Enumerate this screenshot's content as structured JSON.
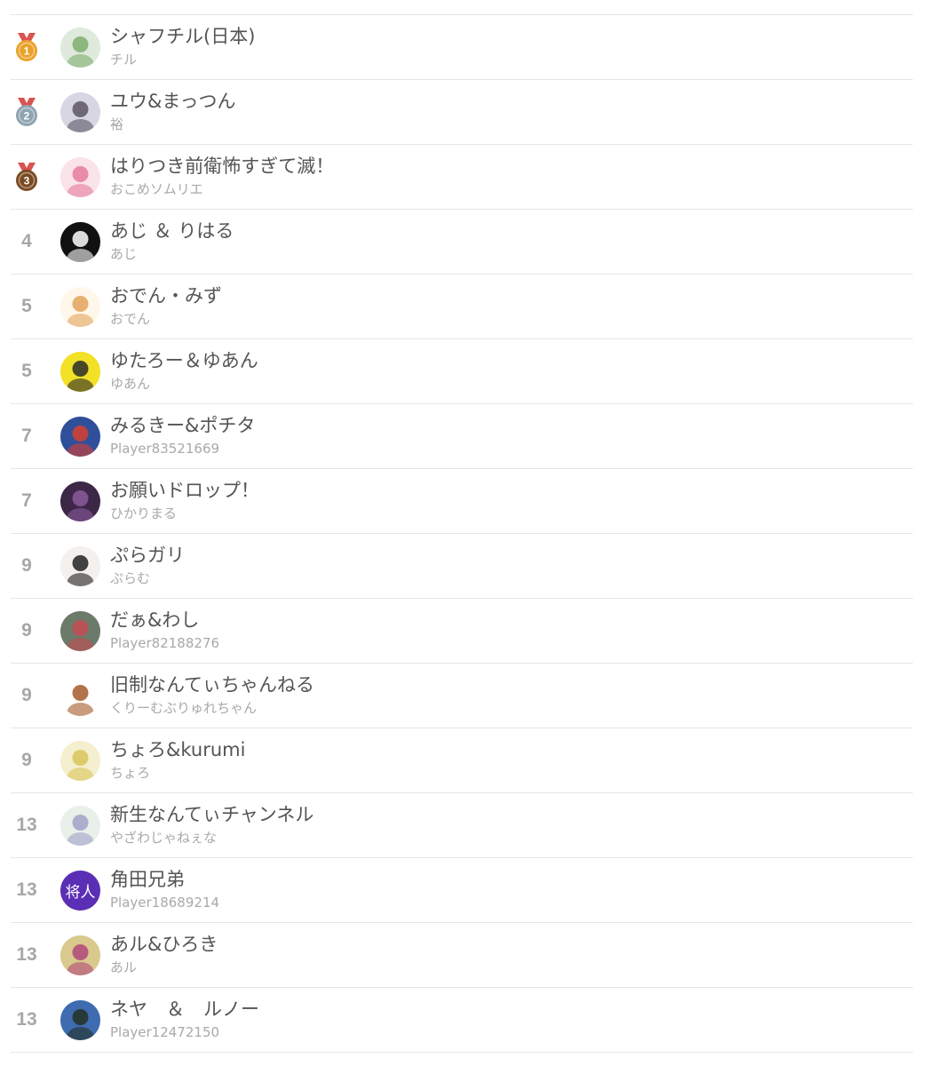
{
  "ranking": {
    "rows": [
      {
        "rank": "1",
        "medal": "gold",
        "name": "シャフチル(日本)",
        "player": "チル",
        "avatar": "avatar-white-character-icon",
        "avatar_bg": "#dfe9dc",
        "avatar_fg": "#7fae6f"
      },
      {
        "rank": "2",
        "medal": "silver",
        "name": "ユウ&まっつん",
        "player": "裕",
        "avatar": "avatar-anime-character-icon",
        "avatar_bg": "#d9d6e4",
        "avatar_fg": "#5a5566"
      },
      {
        "rank": "3",
        "medal": "bronze",
        "name": "はりつき前衛怖すぎて滅！",
        "player": "おこめソムリエ",
        "avatar": "avatar-pink-mushroom-icon",
        "avatar_bg": "#fbe3ea",
        "avatar_fg": "#e67c9b"
      },
      {
        "rank": "4",
        "medal": "",
        "name": "あじ ＆ りはる",
        "player": "あじ",
        "avatar": "avatar-black-logo-icon",
        "avatar_bg": "#111111",
        "avatar_fg": "#ffffff"
      },
      {
        "rank": "5",
        "medal": "",
        "name": "おでん・みず",
        "player": "おでん",
        "avatar": "avatar-sketch-character-icon",
        "avatar_bg": "#fff7ea",
        "avatar_fg": "#e3a35a"
      },
      {
        "rank": "5",
        "medal": "",
        "name": "ゆたろー＆ゆあん",
        "player": "ゆあん",
        "avatar": "avatar-yellow-character-icon",
        "avatar_bg": "#f2e125",
        "avatar_fg": "#2a2a2a"
      },
      {
        "rank": "7",
        "medal": "",
        "name": "みるきー&ポチタ",
        "player": "Player83521669",
        "avatar": "avatar-game-scene-icon",
        "avatar_bg": "#2f4f9b",
        "avatar_fg": "#d8402e"
      },
      {
        "rank": "7",
        "medal": "",
        "name": "お願いドロップ！",
        "player": "ひかりまる",
        "avatar": "avatar-purple-room-icon",
        "avatar_bg": "#3c2747",
        "avatar_fg": "#8a5c9c"
      },
      {
        "rank": "9",
        "medal": "",
        "name": "ぷらガリ",
        "player": "ぷらむ",
        "avatar": "avatar-squid-character-icon",
        "avatar_bg": "#f3f0ee",
        "avatar_fg": "#222222"
      },
      {
        "rank": "9",
        "medal": "",
        "name": "だぁ&わし",
        "player": "Player82188276",
        "avatar": "avatar-figure-icon",
        "avatar_bg": "#6c7a6a",
        "avatar_fg": "#c44b52"
      },
      {
        "rank": "9",
        "medal": "",
        "name": "旧制なんてぃちゃんねる",
        "player": "くりーむぶりゅれちゃん",
        "avatar": "avatar-brown-dog-icon",
        "avatar_bg": "#ffffff",
        "avatar_fg": "#a65a2a"
      },
      {
        "rank": "9",
        "medal": "",
        "name": "ちょろ&kurumi",
        "player": "ちょろ",
        "avatar": "avatar-pichu-icon",
        "avatar_bg": "#f4efcf",
        "avatar_fg": "#d9c45a"
      },
      {
        "rank": "13",
        "medal": "",
        "name": "新生なんてぃチャンネル",
        "player": "やざわじゃねぇな",
        "avatar": "avatar-pastel-figure-icon",
        "avatar_bg": "#e9efe9",
        "avatar_fg": "#a2a2c8"
      },
      {
        "rank": "13",
        "medal": "",
        "name": "角田兄弟",
        "player": "Player18689214",
        "avatar": "avatar-text-icon",
        "avatar_text": "将人",
        "avatar_bg": "#5a2fb5",
        "avatar_fg": "#ffffff"
      },
      {
        "rank": "13",
        "medal": "",
        "name": "あル&ひろき",
        "player": "あル",
        "avatar": "avatar-face-closeup-icon",
        "avatar_bg": "#d9c98d",
        "avatar_fg": "#b0487a"
      },
      {
        "rank": "13",
        "medal": "",
        "name": "ネヤ　＆　ルノー",
        "player": "Player12472150",
        "avatar": "avatar-stadium-photo-icon",
        "avatar_bg": "#3f6bb0",
        "avatar_fg": "#233123"
      }
    ]
  },
  "colors": {
    "gold": "#e9a22a",
    "silver": "#8fa3b0",
    "bronze": "#7a4a22",
    "ribbon": "#d9534f"
  }
}
